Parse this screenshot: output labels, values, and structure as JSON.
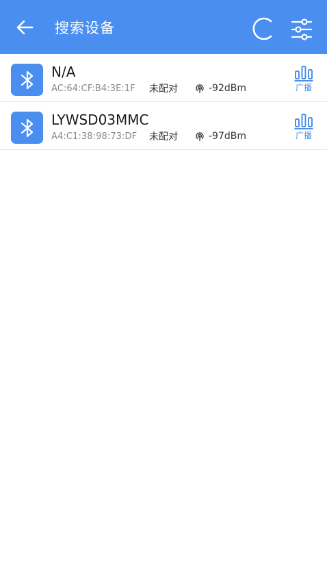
{
  "header": {
    "title": "搜索设备",
    "back_icon": "arrow-left-icon",
    "refresh_icon": "refresh-spinner-icon",
    "filter_icon": "filter-sliders-icon"
  },
  "colors": {
    "primary": "#4a8ef0",
    "divider": "#e6e6e6",
    "mac_text": "#8a8a8a"
  },
  "devices": [
    {
      "name": "N/A",
      "mac": "AC:64:CF:B4:3E:1F",
      "pair_status": "未配对",
      "rssi": "-92dBm",
      "advertise_label": "广播"
    },
    {
      "name": "LYWSD03MMC",
      "mac": "A4:C1:38:98:73:DF",
      "pair_status": "未配对",
      "rssi": "-97dBm",
      "advertise_label": "广播"
    }
  ]
}
